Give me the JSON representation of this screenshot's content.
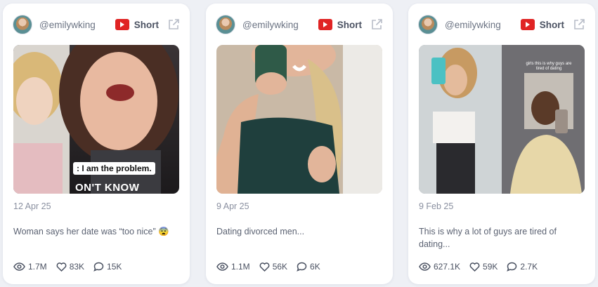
{
  "cards": [
    {
      "handle": "@emilywking",
      "type_label": "Short",
      "date": "12 Apr 25",
      "title": "Woman says her date was “too nice” 😨",
      "overlay_caption": ": I am the problem.",
      "overlay_big": "ON'T KNOW",
      "views": "1.7M",
      "likes": "83K",
      "comments": "15K"
    },
    {
      "handle": "@emilywking",
      "type_label": "Short",
      "date": "9 Apr 25",
      "title": "Dating divorced men...",
      "views": "1.1M",
      "likes": "56K",
      "comments": "6K"
    },
    {
      "handle": "@emilywking",
      "type_label": "Short",
      "date": "9 Feb 25",
      "title": "This is why a lot of guys are tired of dating...",
      "overlay_small": "girls this is why guys are tired of dating",
      "views": "627.1K",
      "likes": "59K",
      "comments": "2.7K"
    }
  ],
  "icons": {
    "platform": "youtube-icon",
    "external": "external-link-icon",
    "views": "eye-icon",
    "likes": "heart-icon",
    "comments": "comment-icon"
  },
  "colors": {
    "youtube_red": "#e02424",
    "page_bg": "#eef0f5",
    "muted_text": "#8a90a0"
  }
}
